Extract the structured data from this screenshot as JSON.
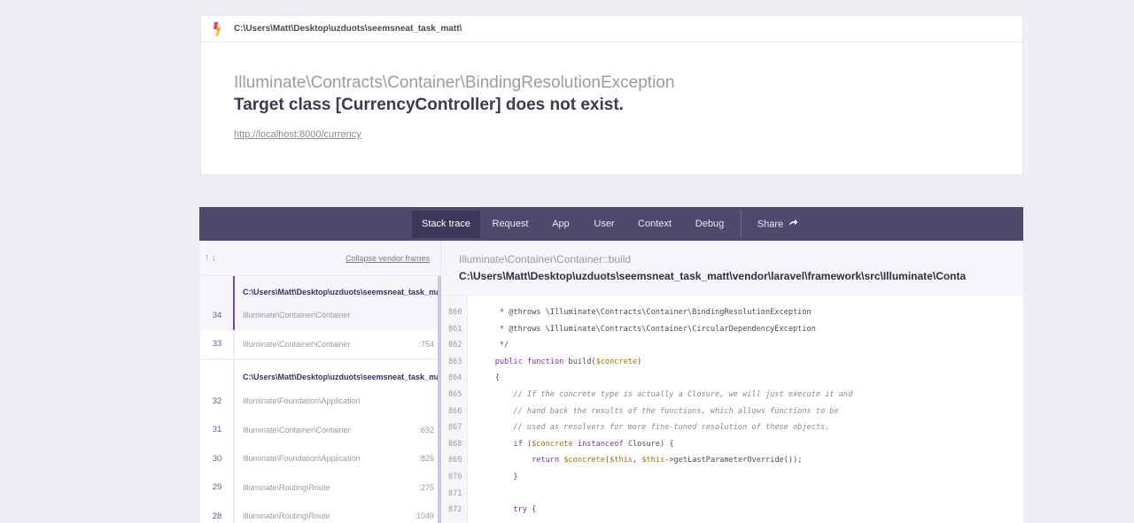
{
  "header": {
    "path": "C:\\Users\\Matt\\Desktop\\uzduots\\seemsneat_task_matt\\",
    "exception_class": "Illuminate\\Contracts\\Container\\BindingResolutionException",
    "message": "Target class [CurrencyController] does not exist.",
    "url": "http://localhost:8000/currency"
  },
  "tabs": [
    {
      "label": "Stack trace",
      "active": true
    },
    {
      "label": "Request",
      "active": false
    },
    {
      "label": "App",
      "active": false
    },
    {
      "label": "User",
      "active": false
    },
    {
      "label": "Context",
      "active": false
    },
    {
      "label": "Debug",
      "active": false
    },
    {
      "label": "Share",
      "active": false
    }
  ],
  "stack": {
    "collapse_label": "Collapse vendor frames",
    "groups": [
      {
        "title": "C:\\Users\\Matt\\Desktop\\uzduots\\seemsneat_task_matt",
        "frames": [
          {
            "num": "34",
            "class": "Illuminate\\Container\\Container",
            "line": ""
          },
          {
            "num": "33",
            "class": "Illuminate\\Container\\Container",
            "line": ":754"
          }
        ]
      },
      {
        "title": "C:\\Users\\Matt\\Desktop\\uzduots\\seemsneat_task_matt",
        "frames": [
          {
            "num": "32",
            "class": "Illuminate\\Foundation\\Application",
            "line": ""
          },
          {
            "num": "31",
            "class": "Illuminate\\Container\\Container",
            "line": ":692"
          },
          {
            "num": "30",
            "class": "Illuminate\\Foundation\\Application",
            "line": ":826"
          },
          {
            "num": "29",
            "class": "Illuminate\\Routing\\Route",
            "line": ":275"
          },
          {
            "num": "28",
            "class": "Illuminate\\Routing\\Route",
            "line": ":1049"
          }
        ]
      }
    ]
  },
  "code": {
    "class": "Illuminate\\Container\\Container::build",
    "file": "C:\\Users\\Matt\\Desktop\\uzduots\\seemsneat_task_matt\\vendor\\laravel\\framework\\src\\Illuminate\\Conta",
    "lines": [
      {
        "num": "860",
        "text": "     * @throws \\Illuminate\\Contracts\\Container\\BindingResolutionException"
      },
      {
        "num": "861",
        "text": "     * @throws \\Illuminate\\Contracts\\Container\\CircularDependencyException"
      },
      {
        "num": "862",
        "text": "     */"
      },
      {
        "num": "863",
        "text": "    public function build($concrete)"
      },
      {
        "num": "864",
        "text": "    {"
      },
      {
        "num": "865",
        "text": "        // If the concrete type is actually a Closure, we will just execute it and"
      },
      {
        "num": "866",
        "text": "        // hand back the results of the functions, which allows functions to be"
      },
      {
        "num": "867",
        "text": "        // used as resolvers for more fine-tuned resolution of these objects."
      },
      {
        "num": "868",
        "text": "        if ($concrete instanceof Closure) {"
      },
      {
        "num": "869",
        "text": "            return $concrete($this, $this->getLastParameterOverride());"
      },
      {
        "num": "870",
        "text": "        }"
      },
      {
        "num": "871",
        "text": ""
      },
      {
        "num": "872",
        "text": "        try {"
      }
    ]
  }
}
